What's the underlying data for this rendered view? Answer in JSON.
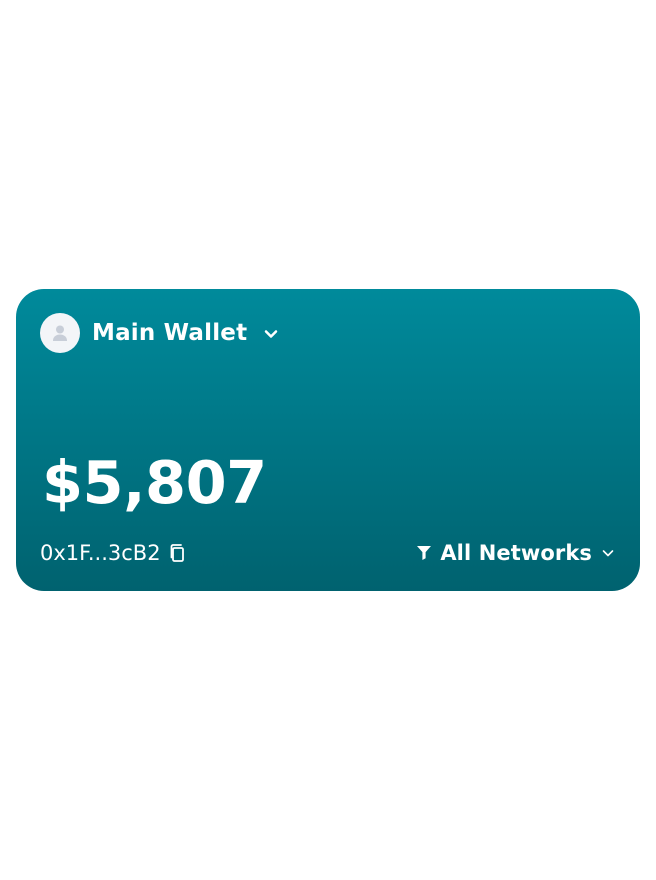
{
  "wallet": {
    "name": "Main Wallet",
    "balance": "$5,807",
    "address": "0x1F...3cB2",
    "network_filter": "All Networks"
  },
  "icons": {
    "avatar": "user-avatar-icon",
    "wallet_dropdown": "chevron-down-icon",
    "copy": "copy-icon",
    "filter": "filter-icon",
    "network_dropdown": "chevron-down-icon"
  },
  "colors": {
    "card_gradient_start": "#008a9b",
    "card_gradient_end": "#00626f",
    "text": "#ffffff",
    "avatar_background": "#f3f5f8",
    "avatar_icon": "#c8ced8"
  }
}
